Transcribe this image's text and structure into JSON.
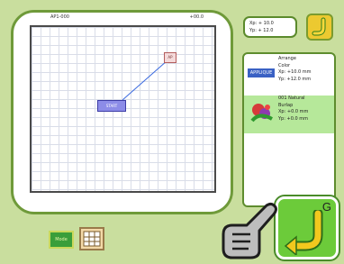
{
  "preview": {
    "header_left": "AP1-000",
    "header_right": "+00.0",
    "marker_top": "AP",
    "marker_mid": "START"
  },
  "size_info": {
    "line1": "Xp: + 10.0",
    "line2": "Yp: + 12.0"
  },
  "color_list": {
    "entry1": {
      "tag": "APPLIQUE",
      "lines": [
        "Arrange",
        "Color",
        "Xp: +10.0 mm",
        "Yp: +12.0 mm"
      ]
    },
    "entry2": {
      "lines": [
        "001  Natural",
        "Burlap",
        "Xp: +0.0 mm",
        "Yp: +0.0 mm"
      ]
    }
  },
  "bottom": {
    "mode_label": "Mode"
  },
  "big_button": {
    "letter": "G"
  },
  "colors": {
    "background": "#c9de9e",
    "frame_border": "#6f9a3a",
    "selected_row": "#b6e89a",
    "return_button": "#6ccb3a",
    "return_arrow": "#f2c81e"
  },
  "icons": {
    "small_back": "return-arrow-icon",
    "big_back": "return-arrow-icon",
    "pointer": "pointing-hand-icon",
    "grid": "grid-icon",
    "pattern": "flower-pattern-icon"
  }
}
